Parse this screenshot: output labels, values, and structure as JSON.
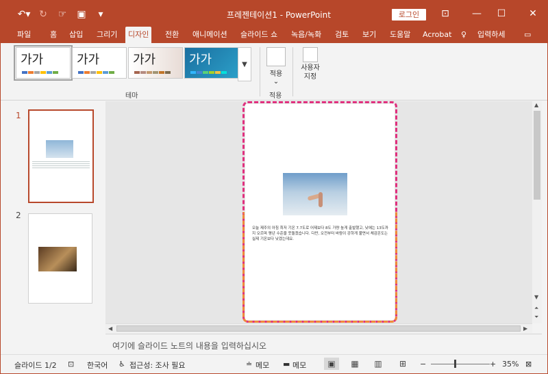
{
  "app": {
    "title": "프레젠테이션1  -  PowerPoint",
    "login_label": "로그인"
  },
  "qat": {
    "undo_icon": "undo-icon",
    "redo_icon": "redo-icon",
    "touch_icon": "touch-mode-icon",
    "save_icon": "save-icon",
    "customize_icon": "customize-qat-icon"
  },
  "tabs": [
    {
      "label": "파일"
    },
    {
      "label": "홈"
    },
    {
      "label": "삽입"
    },
    {
      "label": "그리기"
    },
    {
      "label": "디자인"
    },
    {
      "label": "전환"
    },
    {
      "label": "애니메이션"
    },
    {
      "label": "슬라이드 쇼"
    },
    {
      "label": "녹음/녹화"
    },
    {
      "label": "검토"
    },
    {
      "label": "보기"
    },
    {
      "label": "도움말"
    },
    {
      "label": "Acrobat"
    },
    {
      "label": "입력하세"
    }
  ],
  "ribbon": {
    "themes": [
      {
        "sample": "가가",
        "colors": [
          "#4472c4",
          "#ed7d31",
          "#a5a5a5",
          "#ffc000",
          "#5b9bd5",
          "#70ad47"
        ]
      },
      {
        "sample": "가가",
        "colors": [
          "#4472c4",
          "#ed7d31",
          "#a5a5a5",
          "#ffc000",
          "#5b9bd5",
          "#70ad47"
        ]
      },
      {
        "sample": "가가",
        "colors": [
          "#a5644e",
          "#b58b80",
          "#c3986d",
          "#a19574",
          "#c17529",
          "#7b6a4d"
        ]
      },
      {
        "sample": "가가",
        "colors": [
          "#31b6fd",
          "#4584d3",
          "#5bd078",
          "#a5d028",
          "#f5c040",
          "#05e0db"
        ]
      }
    ],
    "theme_group_label": "테마",
    "apply_label": "적용",
    "apply_group_label": "적용",
    "customize_label": "사용자\n지정"
  },
  "slides": [
    {
      "number": "1"
    },
    {
      "number": "2"
    }
  ],
  "slide_text": "오늘 제주의 아침 최저 기온 7.7도로 어제보다 8도 가량 높게 출발했고, 낮에는 13도까지 오르며 평년 수준을 웃돌겠습니다. 다만, 오전부터 바람이 강하게 불면서 체감온도는 실제 기온보다 낮겠는데요.",
  "notes_placeholder": "여기에 슬라이드 노트의 내용을 입력하십시오",
  "status": {
    "slide_counter": "슬라이드 1/2",
    "language": "한국어",
    "accessibility": "접근성: 조사 필요",
    "notes_label": "메모",
    "comments_label": "메모",
    "zoom": "35%"
  },
  "colors": {
    "accent": "#b7472a",
    "dash_top": "#e0307e",
    "dash_bottom": "#f08a3a"
  }
}
